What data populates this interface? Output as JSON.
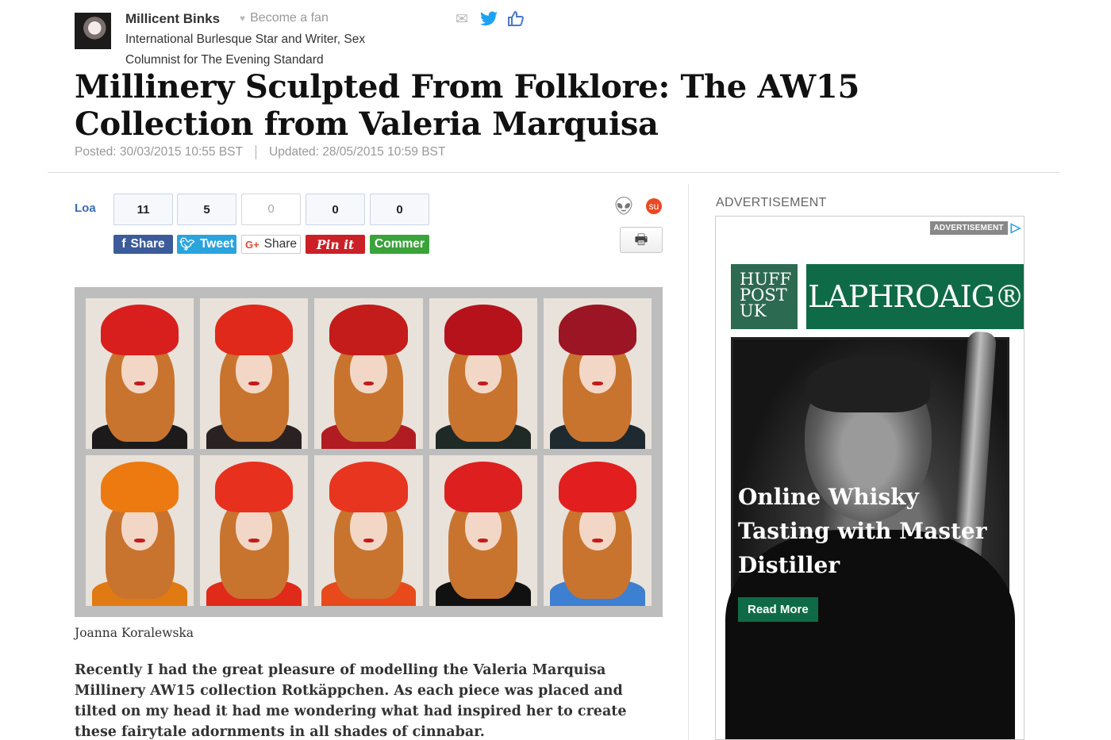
{
  "author": {
    "name": "Millicent Binks",
    "fan_label": "Become a fan",
    "bio": "International Burlesque Star and Writer, Sex Columnist for The Evening Standard"
  },
  "share_icons": [
    "mail-icon",
    "twitter-icon",
    "like-icon"
  ],
  "article": {
    "title": "Millinery Sculpted From Folklore: The AW15 Collection from Valeria Marquisa",
    "posted": "Posted: 30/03/2015 10:55 BST",
    "updated": "Updated: 28/05/2015 10:59 BST",
    "image_caption": "Joanna Koralewska",
    "intro": "Recently I had the great pleasure of modelling the Valeria Marquisa Millinery AW15 collection Rotkäppchen. As each piece was placed and tilted on my head it had me wondering what had inspired her to create these fairytale adornments in all shades of cinnabar."
  },
  "social": {
    "loa_label": "Loa",
    "buttons": [
      {
        "count": "11",
        "label": "Share",
        "icon": "facebook-icon",
        "color": "#3b5b9a"
      },
      {
        "count": "5",
        "label": "Tweet",
        "icon": "twitter-icon",
        "color": "#2aa4dd"
      },
      {
        "count": "0",
        "label": "Share",
        "icon": "google-plus-icon",
        "color": "#ffffff"
      },
      {
        "count": "0",
        "label": "Pin it",
        "icon": "pinterest-icon",
        "color": "#cb2027"
      },
      {
        "count": "0",
        "label": "Commer",
        "icon": "comment-icon",
        "color": "#3aa33a"
      }
    ],
    "extra_icons": [
      "reddit-icon",
      "stumbleupon-icon",
      "print-icon"
    ]
  },
  "hero": {
    "hat_colors": [
      "#d91e1e",
      "#e0291a",
      "#c41b1b",
      "#b5121c",
      "#9c1524",
      "#ec7a10",
      "#e8301e",
      "#e8351f",
      "#dd1f1f",
      "#e21e1e"
    ],
    "body_colors": [
      "#1c1a1a",
      "#2a2222",
      "#b11b22",
      "#1f2a26",
      "#1f2a30",
      "#e07a12",
      "#e02a1a",
      "#e84a1c",
      "#111",
      "#3d7fd0"
    ]
  },
  "ad": {
    "section_label": "ADVERTISEMENT",
    "choice_tag": "ADVERTISEMENT",
    "huff_logo": "HUFF POST UK",
    "brand": "LAPHROAIG®",
    "headline": "Online Whisky Tasting with Master Distiller",
    "cta": "Read More",
    "brand_color": "#0f6b47"
  }
}
